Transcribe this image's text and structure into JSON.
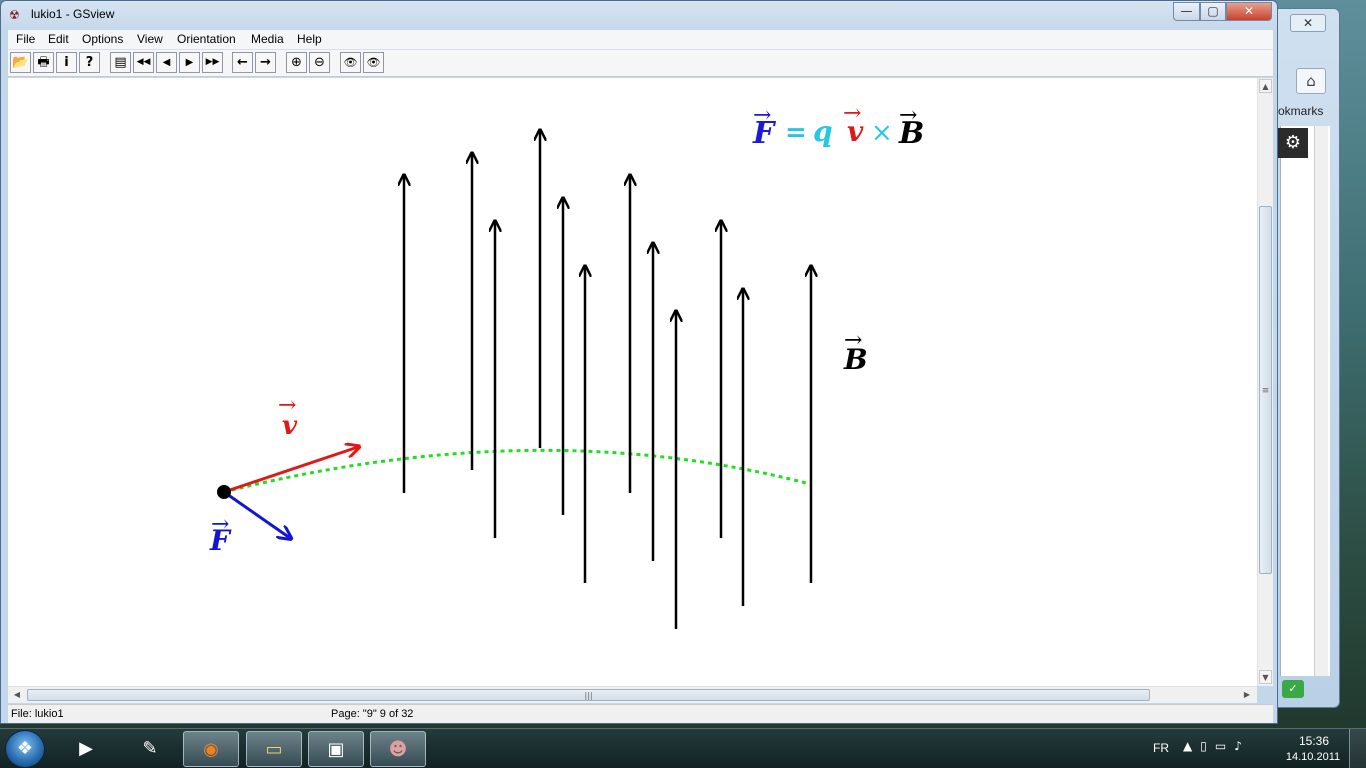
{
  "window": {
    "title": "lukio1 - GSview",
    "minimize_icon": "minimize-icon",
    "maximize_icon": "maximize-icon",
    "close_icon": "close-icon"
  },
  "menu": [
    {
      "label": "File"
    },
    {
      "label": "Edit"
    },
    {
      "label": "Options"
    },
    {
      "label": "View"
    },
    {
      "label": "Orientation"
    },
    {
      "label": "Media"
    },
    {
      "label": "Help"
    }
  ],
  "toolbar": [
    {
      "icon": "open-file-icon",
      "glyph": "📂"
    },
    {
      "icon": "print-icon",
      "glyph": "🖶"
    },
    {
      "icon": "info-icon",
      "glyph": "i"
    },
    {
      "icon": "help-icon",
      "glyph": "?"
    },
    {
      "icon": "goto-page-icon",
      "glyph": "▤"
    },
    {
      "icon": "skip-back-icon",
      "glyph": "◀◀"
    },
    {
      "icon": "previous-page-icon",
      "glyph": "◀"
    },
    {
      "icon": "next-page-icon",
      "glyph": "▶"
    },
    {
      "icon": "skip-forward-icon",
      "glyph": "▶▶"
    },
    {
      "icon": "back-icon",
      "glyph": "←"
    },
    {
      "icon": "forward-icon",
      "glyph": "→"
    },
    {
      "icon": "zoom-in-icon",
      "glyph": "⊕"
    },
    {
      "icon": "zoom-out-icon",
      "glyph": "⊖"
    },
    {
      "icon": "find-text-icon",
      "glyph": "👁"
    },
    {
      "icon": "find-next-icon",
      "glyph": "👁"
    }
  ],
  "document": {
    "formula": {
      "F": "F",
      "equals": "=",
      "q": "q",
      "v": "v",
      "times": "×",
      "B": "B",
      "arrow": "→",
      "colors": {
        "F": "#1a1ad9",
        "q": "#22c8e6",
        "v": "#e02020",
        "B": "#000000"
      }
    },
    "label_B": "B",
    "label_v": "v",
    "label_F": "F",
    "colors": {
      "field_lines": "#000000",
      "velocity": "#e01818",
      "force": "#1414d4",
      "trajectory": "#22dd22"
    }
  },
  "status": {
    "file": "File: lukio1",
    "page": "Page: \"9\"  9 of 32"
  },
  "background_window": {
    "bookmarks_label": "okmarks"
  },
  "taskbar": {
    "apps": [
      {
        "name": "media-player-icon",
        "glyph": "▶"
      },
      {
        "name": "paint-icon",
        "glyph": "✎"
      },
      {
        "name": "firefox-icon",
        "glyph": "◉"
      },
      {
        "name": "explorer-icon",
        "glyph": "▭"
      },
      {
        "name": "document-viewer-icon",
        "glyph": "▣"
      },
      {
        "name": "gsview-icon",
        "glyph": "☻"
      }
    ],
    "language": "FR",
    "time": "15:36",
    "date": "14.10.2011"
  }
}
